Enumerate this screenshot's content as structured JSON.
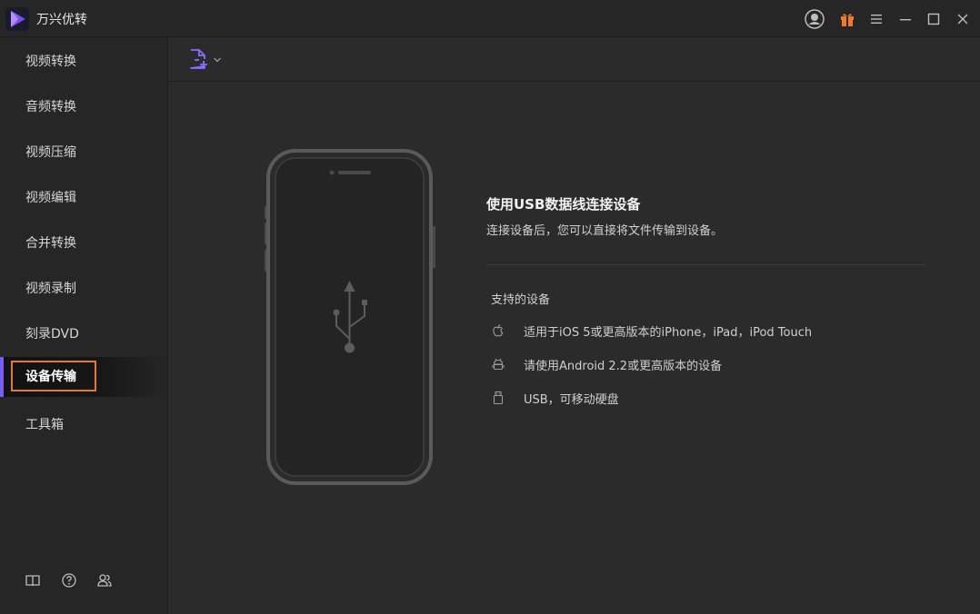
{
  "app": {
    "title": "万兴优转",
    "accent_color": "#7b5cf5",
    "highlight_color": "#e8782a"
  },
  "titlebar_icons": [
    "account-icon",
    "gift-icon",
    "menu-icon",
    "minimize-icon",
    "maximize-icon",
    "close-icon"
  ],
  "sidebar": {
    "items": [
      {
        "label": "视频转换"
      },
      {
        "label": "音频转换"
      },
      {
        "label": "视频压缩"
      },
      {
        "label": "视频编辑"
      },
      {
        "label": "合并转换"
      },
      {
        "label": "视频录制"
      },
      {
        "label": "刻录DVD"
      },
      {
        "label": "设备传输",
        "active": true
      },
      {
        "label": "工具箱"
      }
    ],
    "footer_icons": [
      "book-icon",
      "help-icon",
      "users-icon"
    ]
  },
  "toolbar": {
    "add_file_icon": "add-file-icon",
    "dropdown_icon": "chevron-down-icon"
  },
  "main": {
    "title": "使用USB数据线连接设备",
    "subtitle": "连接设备后，您可以直接将文件传输到设备。",
    "supported_title": "支持的设备",
    "devices": [
      {
        "icon": "apple-icon",
        "text": "适用于iOS 5或更高版本的iPhone，iPad，iPod Touch"
      },
      {
        "icon": "android-icon",
        "text": "请使用Android 2.2或更高版本的设备"
      },
      {
        "icon": "usb-drive-icon",
        "text": "USB，可移动硬盘"
      }
    ]
  }
}
